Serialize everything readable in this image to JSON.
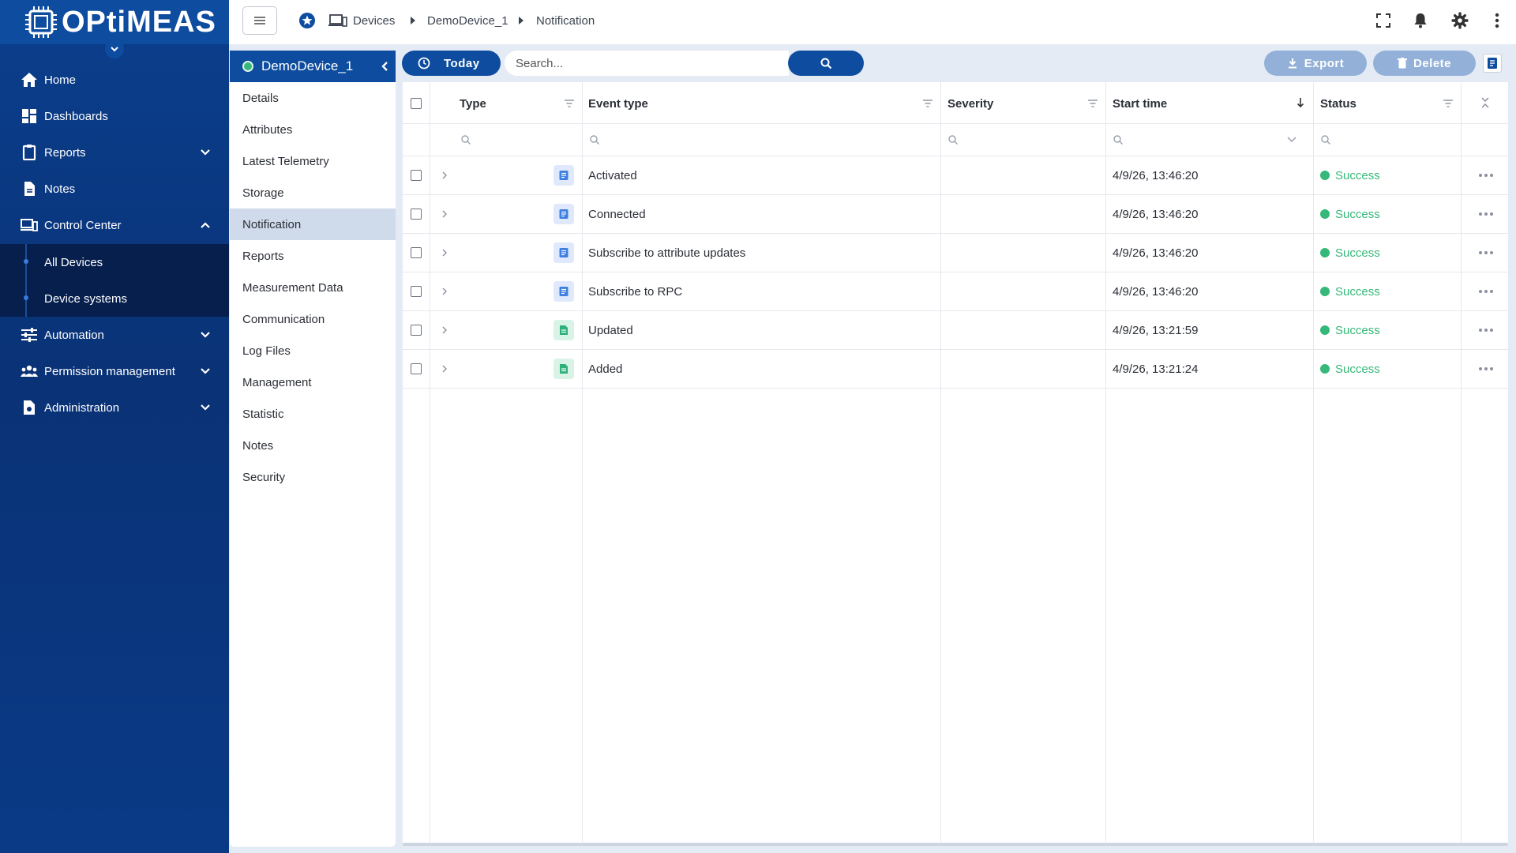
{
  "brand": {
    "logo_text": "OPtiMEAS"
  },
  "nav": {
    "items": [
      {
        "label": "Home"
      },
      {
        "label": "Dashboards"
      },
      {
        "label": "Reports"
      },
      {
        "label": "Notes"
      },
      {
        "label": "Control Center"
      },
      {
        "label": "All Devices"
      },
      {
        "label": "Device systems"
      },
      {
        "label": "Automation"
      },
      {
        "label": "Permission management"
      },
      {
        "label": "Administration"
      }
    ]
  },
  "breadcrumb": {
    "items": [
      "Devices",
      "DemoDevice_1",
      "Notification"
    ]
  },
  "device": {
    "name": "DemoDevice_1",
    "status_color": "#35b879"
  },
  "subnav": {
    "items": [
      "Details",
      "Attributes",
      "Latest Telemetry",
      "Storage",
      "Notification",
      "Reports",
      "Measurement Data",
      "Communication",
      "Log Files",
      "Management",
      "Statistic",
      "Notes",
      "Security"
    ],
    "active": "Notification"
  },
  "toolbar": {
    "today_label": "Today",
    "search_placeholder": "Search...",
    "export_label": "Export",
    "delete_label": "Delete"
  },
  "table": {
    "columns": [
      "Type",
      "Event type",
      "Severity",
      "Start time",
      "Status"
    ],
    "rows": [
      {
        "type_icon": "document-blue",
        "event_type": "Activated",
        "severity": "",
        "start_time": "4/9/26, 13:46:20",
        "status": "Success"
      },
      {
        "type_icon": "document-blue",
        "event_type": "Connected",
        "severity": "",
        "start_time": "4/9/26, 13:46:20",
        "status": "Success"
      },
      {
        "type_icon": "document-blue",
        "event_type": "Subscribe to attribute updates",
        "severity": "",
        "start_time": "4/9/26, 13:46:20",
        "status": "Success"
      },
      {
        "type_icon": "document-blue",
        "event_type": "Subscribe to RPC",
        "severity": "",
        "start_time": "4/9/26, 13:46:20",
        "status": "Success"
      },
      {
        "type_icon": "document-green",
        "event_type": "Updated",
        "severity": "",
        "start_time": "4/9/26, 13:21:59",
        "status": "Success"
      },
      {
        "type_icon": "document-green",
        "event_type": "Added",
        "severity": "",
        "start_time": "4/9/26, 13:21:24",
        "status": "Success"
      }
    ]
  },
  "colors": {
    "primary": "#0d4c9e",
    "nav_bg": "#0a3276",
    "success": "#35b879",
    "disabled_button": "#93b1d8"
  }
}
